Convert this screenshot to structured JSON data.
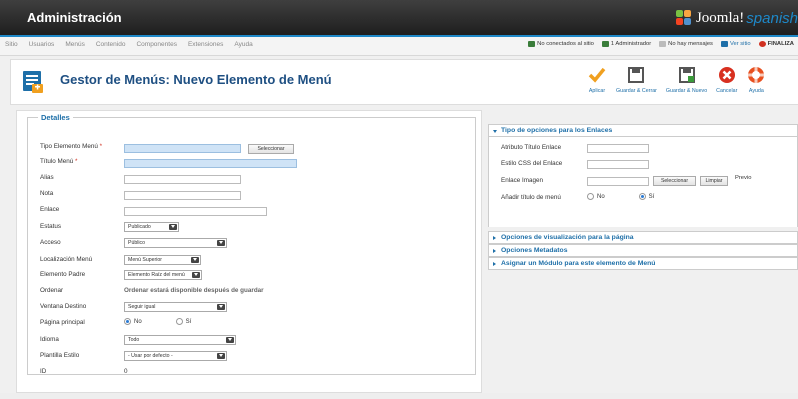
{
  "header": {
    "title": "Administración",
    "logo_text": "Joomla!",
    "logo_suffix": "spanish"
  },
  "menubar": {
    "items": [
      "Sitio",
      "Usuarios",
      "Menús",
      "Contenido",
      "Componentes",
      "Extensiones",
      "Ayuda"
    ]
  },
  "status": [
    {
      "text": "No conectados al sitio",
      "color": "#3a7d3a",
      "icon": "users-icon"
    },
    {
      "text": "1 Administrador",
      "color": "#3a7d3a",
      "icon": "user-icon"
    },
    {
      "text": "No hay mensajes",
      "color": "#999999",
      "icon": "mail-icon"
    },
    {
      "text": "Ver sitio",
      "color": "#1e6fa8",
      "icon": "monitor-icon"
    },
    {
      "text": "FINALIZA",
      "color": "#d03020",
      "icon": "power-icon"
    }
  ],
  "page": {
    "title": "Gestor de Menús: Nuevo Elemento de Menú"
  },
  "toolbar": [
    {
      "label": "Aplicar",
      "icon": "check-icon"
    },
    {
      "label": "Guardar & Cerrar",
      "icon": "save-icon"
    },
    {
      "label": "Guardar & Nuevo",
      "icon": "save-new-icon"
    },
    {
      "label": "Cancelar",
      "icon": "cancel-icon"
    },
    {
      "label": "Ayuda",
      "icon": "help-icon"
    }
  ],
  "details": {
    "legend": "Detalles",
    "labels": {
      "tipo": "Tipo Elemento Menú",
      "titulo": "Título Menú",
      "alias": "Alias",
      "nota": "Nota",
      "enlace": "Enlace",
      "estatus": "Estatus",
      "acceso": "Acceso",
      "localizacion": "Localización Menú",
      "padre": "Elemento Padre",
      "ordenar": "Ordenar",
      "ventana": "Ventana Destino",
      "principal": "Página principal",
      "idioma": "Idioma",
      "plantilla": "Plantilla Estilo",
      "id": "ID"
    },
    "required_mark": "*",
    "select_button": "Seleccionar",
    "estatus_value": "Publicado",
    "acceso_value": "Público",
    "localizacion_value": "Menú Superior",
    "padre_value": "Elemento Raíz del menú",
    "ordenar_text": "Ordenar estará disponible después de guardar",
    "ventana_value": "Seguir igual",
    "principal_no": "No",
    "principal_si": "Sí",
    "idioma_value": "Todo",
    "plantilla_value": "- Usar por defecto -",
    "id_value": "0"
  },
  "link_options": {
    "title": "Tipo de opciones para los Enlaces",
    "labels": {
      "attr_titulo": "Atributo Título Enlace",
      "css": "Estilo CSS del Enlace",
      "imagen": "Enlace Imagen",
      "anadir": "Añadir título de menú"
    },
    "select_button": "Seleccionar",
    "clear_button": "Limpiar",
    "preview": "Previo",
    "no": "No",
    "si": "Sí"
  },
  "panels": [
    "Opciones de visualización para la página",
    "Opciones Metadatos",
    "Asignar un Módulo para este elemento de Menú"
  ]
}
